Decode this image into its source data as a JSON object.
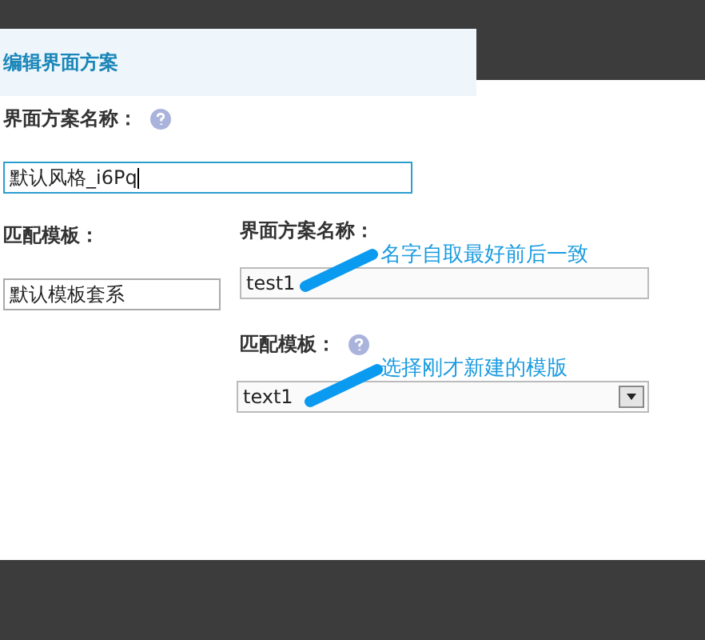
{
  "editor": {
    "title": "编辑界面方案",
    "name_label": "界面方案名称：",
    "name_value": "默认风格_i6Pq",
    "template_label": "匹配模板：",
    "template_value": "默认模板套系"
  },
  "overlay": {
    "name_label": "界面方案名称：",
    "name_value": "test1",
    "name_note": "名字自取最好前后一致",
    "template_label": "匹配模板：",
    "template_value": "text1",
    "template_note": "选择刚才新建的模版"
  }
}
